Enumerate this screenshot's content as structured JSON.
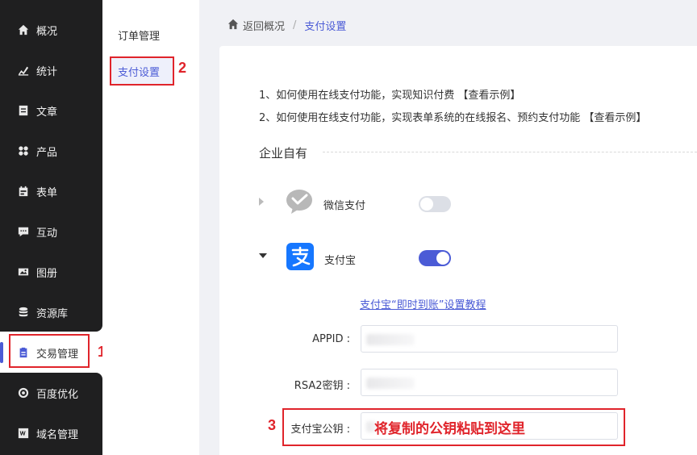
{
  "sidebar": {
    "items": [
      {
        "label": "概况",
        "icon": "home-icon"
      },
      {
        "label": "统计",
        "icon": "chart-icon"
      },
      {
        "label": "文章",
        "icon": "document-icon"
      },
      {
        "label": "产品",
        "icon": "grid-icon"
      },
      {
        "label": "表单",
        "icon": "calendar-icon"
      },
      {
        "label": "互动",
        "icon": "chat-icon"
      },
      {
        "label": "图册",
        "icon": "image-icon"
      },
      {
        "label": "资源库",
        "icon": "database-icon"
      },
      {
        "label": "交易管理",
        "icon": "clipboard-icon"
      },
      {
        "label": "百度优化",
        "icon": "target-icon"
      },
      {
        "label": "域名管理",
        "icon": "domain-icon"
      }
    ],
    "active_index": 8,
    "annotation_number": "1"
  },
  "subnav": {
    "items": [
      "订单管理",
      "支付设置"
    ],
    "active_index": 1,
    "annotation_number": "2"
  },
  "breadcrumb": {
    "back": "返回概况",
    "separator": "/",
    "current": "支付设置"
  },
  "tips": [
    "1、如何使用在线支付功能，实现知识付费 【查看示例】",
    "2、如何使用在线支付功能，实现表单系统的在线报名、预约支付功能 【查看示例】"
  ],
  "section": {
    "title": "企业自有"
  },
  "payments": {
    "wechat": {
      "label": "微信支付",
      "enabled": false
    },
    "alipay": {
      "label": "支付宝",
      "enabled": true
    }
  },
  "guide_link": "支付宝“即时到账”设置教程",
  "form": {
    "appid_label": "APPID :",
    "rsa2_label": "RSA2密钥 :",
    "public_key_label": "支付宝公钥 :"
  },
  "annotation": {
    "number": "3",
    "text": "将复制的公钥粘贴到这里"
  },
  "colors": {
    "accent": "#4b5bd6",
    "sidebar_bg": "#1f1f20",
    "annotation_red": "#e0242b"
  }
}
